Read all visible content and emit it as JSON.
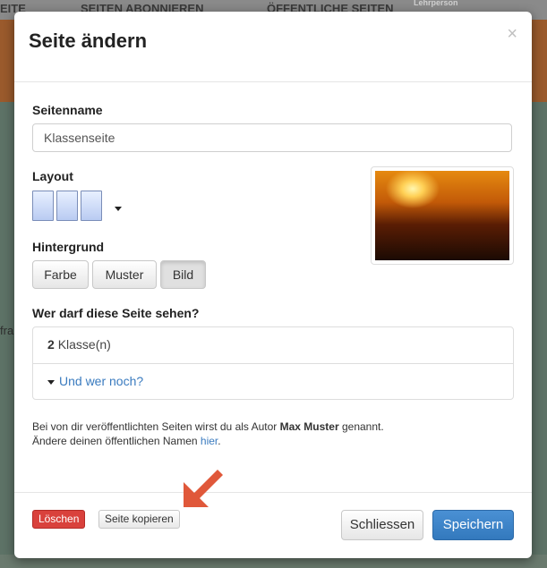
{
  "background": {
    "top_links": [
      "EITE",
      "SEITEN ABONNIEREN",
      "ÖFFENTLICHE SEITEN"
    ],
    "badge": "Lehrperson",
    "side_text": "fra"
  },
  "dialog": {
    "title": "Seite ändern",
    "close_symbol": "×",
    "page_name_label": "Seitenname",
    "page_name_value": "Klassenseite",
    "layout_label": "Layout",
    "background_label": "Hintergrund",
    "background_options": [
      "Farbe",
      "Muster",
      "Bild"
    ],
    "background_selected": "Bild",
    "visibility_label": "Wer darf diese Seite sehen?",
    "visibility_count": "2",
    "visibility_unit": "Klasse(n)",
    "visibility_more": "Und wer noch?",
    "info_line1_prefix": "Bei von dir veröffentlichten Seiten wirst du als Autor",
    "info_author": "Max Muster",
    "info_line1_suffix": "genannt.",
    "info_line2_prefix": "Ändere deinen öffentlichen Namen",
    "info_line2_link": "hier",
    "info_line2_suffix": ".",
    "delete_label": "Löschen",
    "copy_label": "Seite kopieren",
    "close_label": "Schliessen",
    "save_label": "Speichern"
  },
  "colors": {
    "delete": "#d9413c",
    "save": "#3379bd",
    "link": "#3a7bbf",
    "arrow": "#e0583a"
  }
}
